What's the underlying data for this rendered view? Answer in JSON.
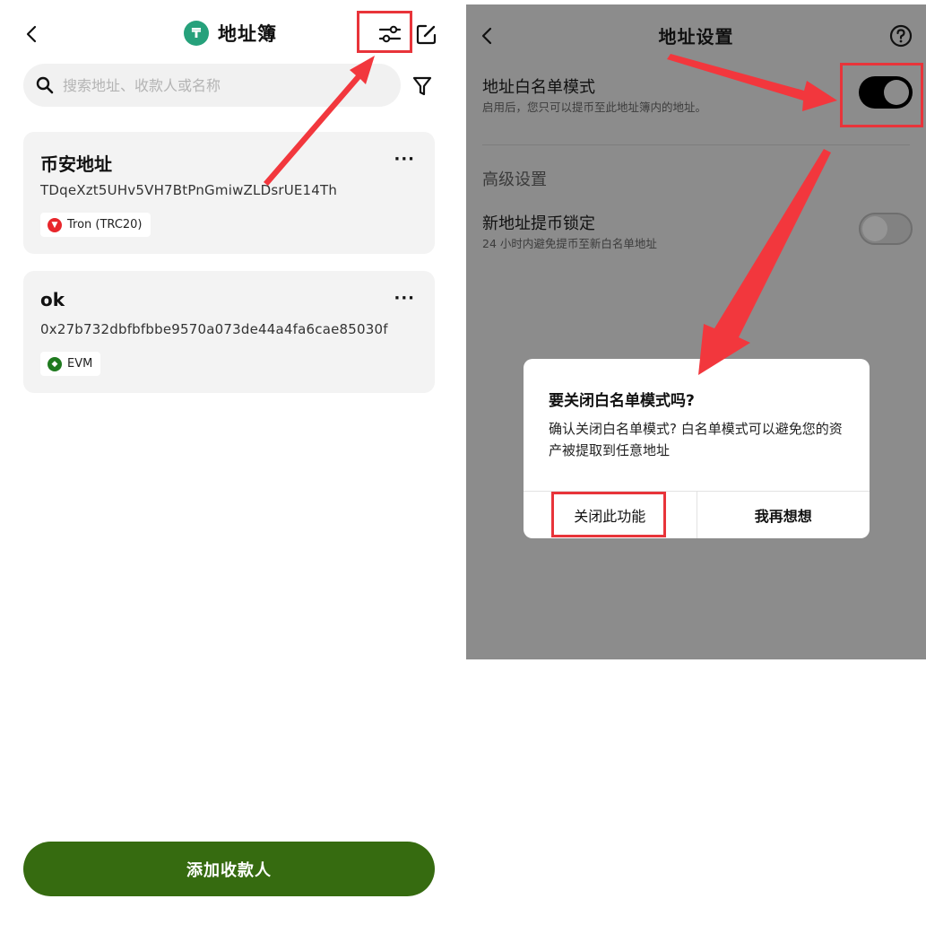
{
  "left": {
    "header": {
      "title": "地址簿",
      "logo_glyph": "₸"
    },
    "search": {
      "placeholder": "搜索地址、收款人或名称"
    },
    "cards": [
      {
        "name": "币安地址",
        "address": "TDqeXzt5UHv5VH7BtPnGmiwZLDsrUE14Th",
        "network": "Tron (TRC20)",
        "network_color": "#e8262b",
        "more": "···"
      },
      {
        "name": "ok",
        "address": "0x27b732dbfbfbbe9570a073de44a4fa6cae85030f",
        "network": "EVM",
        "network_color": "#1f7a1f",
        "more": "···"
      }
    ],
    "add_button": "添加收款人"
  },
  "right": {
    "header": {
      "title": "地址设置"
    },
    "whitelist": {
      "title": "地址白名单模式",
      "subtitle": "启用后，您只可以提币至此地址簿内的地址。",
      "enabled": true
    },
    "advanced_label": "高级设置",
    "new_address_lock": {
      "title": "新地址提币锁定",
      "subtitle": "24 小时内避免提币至新白名单地址",
      "enabled": false
    },
    "dialog": {
      "title": "要关闭白名单模式吗?",
      "message": "确认关闭白名单模式? 白名单模式可以避免您的资产被提取到任意地址",
      "confirm": "关闭此功能",
      "cancel": "我再想想"
    }
  },
  "colors": {
    "accent_green": "#366b10",
    "highlight_red": "#e8343a",
    "tether_green": "#26a17b"
  }
}
